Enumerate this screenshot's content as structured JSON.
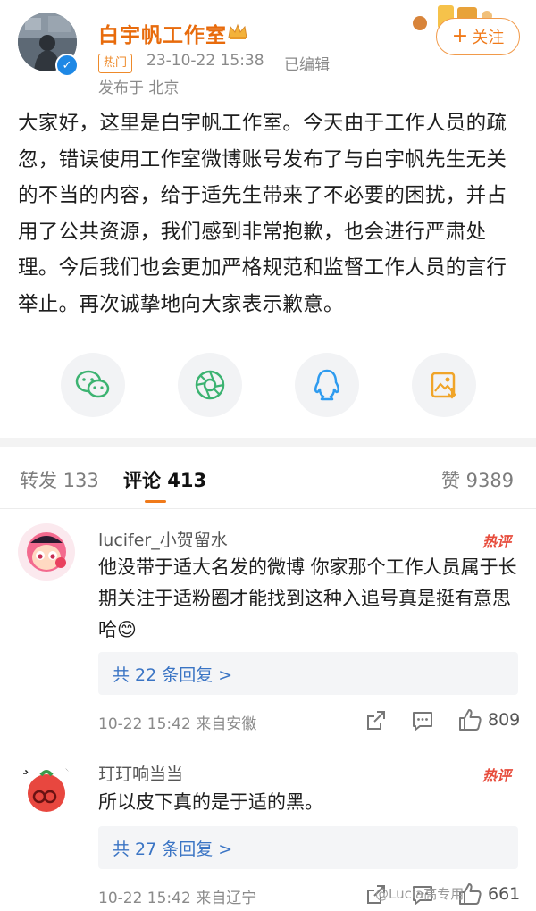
{
  "post": {
    "author": "白宇帆工作室",
    "hot_tag": "热门",
    "time": "23-10-22 15:38",
    "edited": "已编辑",
    "location": "发布于 北京",
    "follow_label": "关注",
    "text": "大家好，这里是白宇帆工作室。今天由于工作人员的疏忽，错误使用工作室微博账号发布了与白宇帆先生无关的不当的内容，给于适先生带来了不必要的困扰，并占用了公共资源，我们感到非常抱歉，也会进行严肃处理。今后我们也会更加严格规范和监督工作人员的言行举止。再次诚挚地向大家表示歉意。"
  },
  "share": {
    "icons": [
      "wechat-icon",
      "moments-icon",
      "qq-icon",
      "save-image-icon"
    ]
  },
  "tabs": {
    "repost": "转发 133",
    "comments": "评论 413",
    "likes": "赞 9389"
  },
  "comments": [
    {
      "user": "lucifer_小贺留水",
      "hot": "热评",
      "text": "他没带于适大名发的微博 你家那个工作人员属于长期关注于适粉圈才能找到这种入追号真是挺有意思哈😊",
      "replies": "共 22 条回复 >",
      "meta": "10-22 15:42 来自安徽",
      "likes": "809"
    },
    {
      "user": "玎玎响当当",
      "hot": "热评",
      "text": "所以皮下真的是于适的黑。",
      "replies": "共 27 条回复 >",
      "meta": "10-22 15:42 来自辽宁",
      "likes": "661"
    }
  ],
  "watermark": "@Lucia高专用",
  "colors": {
    "author_orange": "#e86b0c",
    "accent_orange": "#f07a1a",
    "link_blue": "#3a74c4",
    "hot_red": "#e74c3c"
  }
}
